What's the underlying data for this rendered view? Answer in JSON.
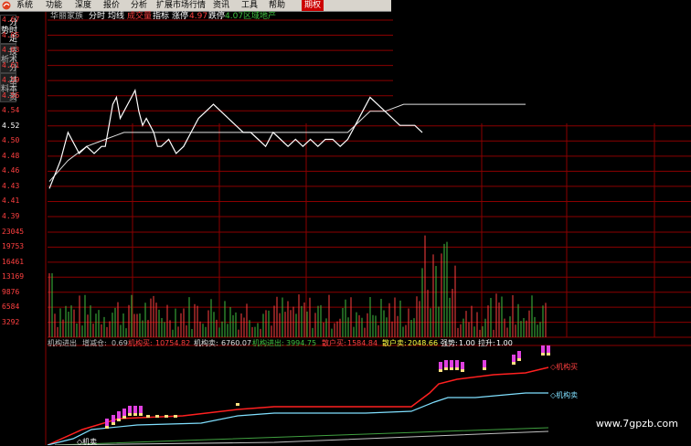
{
  "menu": [
    {
      "label": "系统"
    },
    {
      "label": "功能"
    },
    {
      "label": "深度"
    },
    {
      "label": "报价"
    },
    {
      "label": "分析"
    },
    {
      "label": "扩展市场行情"
    },
    {
      "label": "资讯"
    },
    {
      "label": "工具"
    },
    {
      "label": "帮助"
    },
    {
      "label": "期权"
    }
  ],
  "sidetabs": [
    "分时走势",
    "技术分析",
    "基本资料"
  ],
  "header": {
    "stock": "华丽家族",
    "mode1": "分时",
    "mode2": "均线",
    "mode3": "成交量",
    "mode4": "指标",
    "limit_up_label": "涨停",
    "limit_up": "4.97",
    "limit_down_label": "跌停",
    "limit_down": "4.07",
    "sector": "区域地产"
  },
  "price_axis": [
    "4.67",
    "4.65",
    "4.63",
    "4.61",
    "4.59",
    "4.56",
    "4.54",
    "4.52",
    "4.50",
    "4.48",
    "4.46",
    "4.43",
    "4.41",
    "4.39"
  ],
  "volume_axis": [
    "23045",
    "19753",
    "16461",
    "13169",
    "9876",
    "6584",
    "3292"
  ],
  "indicator": {
    "name": "机构进出",
    "p1_label": "增减仓:",
    "p1": "0.69",
    "p2_label": "机构买:",
    "p2": "10754.82",
    "p3_label": "机构卖:",
    "p3": "6760.07",
    "p4_label": "机构进出:",
    "p4": "3994.75",
    "p5_label": "散户买:",
    "p5": "1584.84",
    "p6_label": "散户卖:",
    "p6": "2048.66",
    "p7_label": "强势:",
    "p7": "1.00",
    "p8_label": "拉升:",
    "p8": "1.00"
  },
  "labels": {
    "buy": "机构买",
    "sell": "机构卖",
    "sell_bottom": "机卖"
  },
  "watermark": "www.7gpzb.com",
  "colors": {
    "grid": "#8b0000",
    "price": "#ffffff",
    "avg": "#e0e0e0",
    "buy": "#ff2020",
    "sell": "#80e0ff",
    "up_bar": "#ff4040",
    "down_bar": "#40c040"
  },
  "chart_data": {
    "type": "line",
    "price_series": {
      "x": [
        0,
        3,
        5,
        8,
        10,
        12,
        14,
        15,
        16,
        17,
        18,
        19,
        20,
        21,
        22,
        23,
        24,
        25,
        26,
        27,
        28,
        29,
        30,
        32,
        34,
        36,
        38,
        40,
        42,
        44,
        46,
        48,
        50,
        52,
        54,
        56,
        58,
        60,
        62,
        64,
        66,
        68,
        70,
        72,
        74,
        76,
        78,
        80,
        82,
        84,
        86,
        88,
        90,
        92,
        94,
        96,
        98,
        100
      ],
      "y": [
        4.43,
        4.47,
        4.51,
        4.48,
        4.49,
        4.48,
        4.49,
        4.49,
        4.52,
        4.55,
        4.56,
        4.53,
        4.54,
        4.55,
        4.56,
        4.57,
        4.54,
        4.52,
        4.53,
        4.52,
        4.51,
        4.49,
        4.49,
        4.5,
        4.48,
        4.49,
        4.51,
        4.53,
        4.54,
        4.55,
        4.54,
        4.53,
        4.52,
        4.51,
        4.51,
        4.5,
        4.49,
        4.51,
        4.5,
        4.49,
        4.5,
        4.49,
        4.5,
        4.49,
        4.5,
        4.5,
        4.49,
        4.5,
        4.52,
        4.54,
        4.56,
        4.55,
        4.54,
        4.53,
        4.52,
        4.52,
        4.52,
        4.51
      ]
    },
    "avg_series": {
      "x": [
        0,
        5,
        10,
        15,
        20,
        25,
        30,
        40,
        50,
        60,
        70,
        80,
        82,
        84,
        86,
        90,
        95,
        100
      ],
      "y": [
        4.44,
        4.47,
        4.49,
        4.5,
        4.51,
        4.51,
        4.51,
        4.51,
        4.51,
        4.51,
        4.51,
        4.51,
        4.52,
        4.53,
        4.54,
        4.54,
        4.55,
        4.55
      ]
    },
    "ylim": [
      4.39,
      4.67
    ]
  }
}
